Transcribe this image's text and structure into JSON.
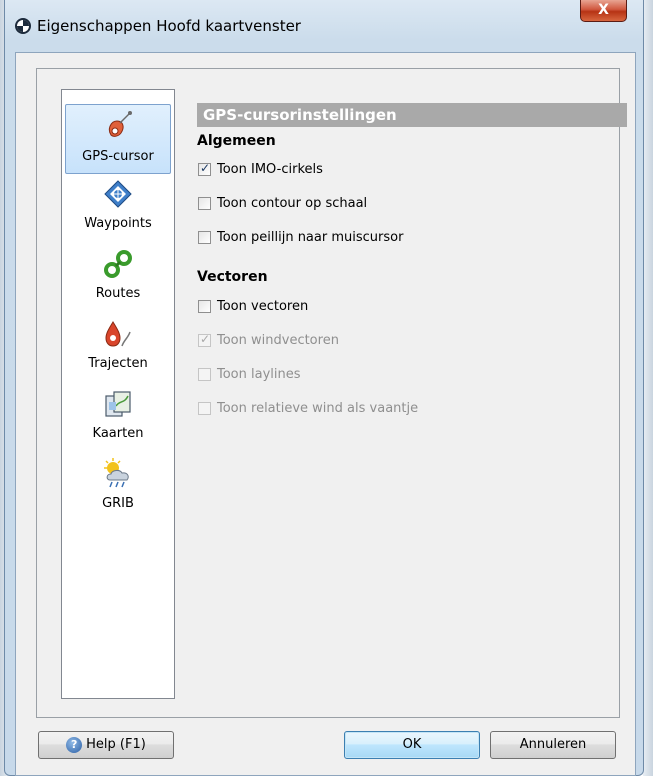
{
  "window": {
    "title": "Eigenschappen Hoofd kaartvenster",
    "close_label": "X"
  },
  "sidebar": {
    "items": [
      {
        "label": "GPS-cursor",
        "icon": "gps-cursor-icon",
        "selected": true
      },
      {
        "label": "Waypoints",
        "icon": "waypoint-icon",
        "selected": false
      },
      {
        "label": "Routes",
        "icon": "route-icon",
        "selected": false
      },
      {
        "label": "Trajecten",
        "icon": "track-icon",
        "selected": false
      },
      {
        "label": "Kaarten",
        "icon": "charts-icon",
        "selected": false
      },
      {
        "label": "GRIB",
        "icon": "grib-weather-icon",
        "selected": false
      }
    ]
  },
  "pane": {
    "header": "GPS-cursorinstellingen",
    "groups": [
      {
        "heading": "Algemeen",
        "options": [
          {
            "label": "Toon IMO-cirkels",
            "checked": true,
            "enabled": true
          },
          {
            "label": "Toon contour op schaal",
            "checked": false,
            "enabled": true
          },
          {
            "label": "Toon peillijn naar muiscursor",
            "checked": false,
            "enabled": true
          }
        ]
      },
      {
        "heading": "Vectoren",
        "options": [
          {
            "label": "Toon vectoren",
            "checked": false,
            "enabled": true
          },
          {
            "label": "Toon windvectoren",
            "checked": true,
            "enabled": false
          },
          {
            "label": "Toon laylines",
            "checked": false,
            "enabled": false
          },
          {
            "label": "Toon relatieve wind als vaantje",
            "checked": false,
            "enabled": false
          }
        ]
      }
    ]
  },
  "footer": {
    "help_label": "Help (F1)",
    "help_icon": "help-icon",
    "ok_label": "OK",
    "cancel_label": "Annuleren"
  },
  "colors": {
    "header_bg": "#a9a9a9",
    "selection_bg": "#cce4fb",
    "close_button": "#c7432a"
  }
}
